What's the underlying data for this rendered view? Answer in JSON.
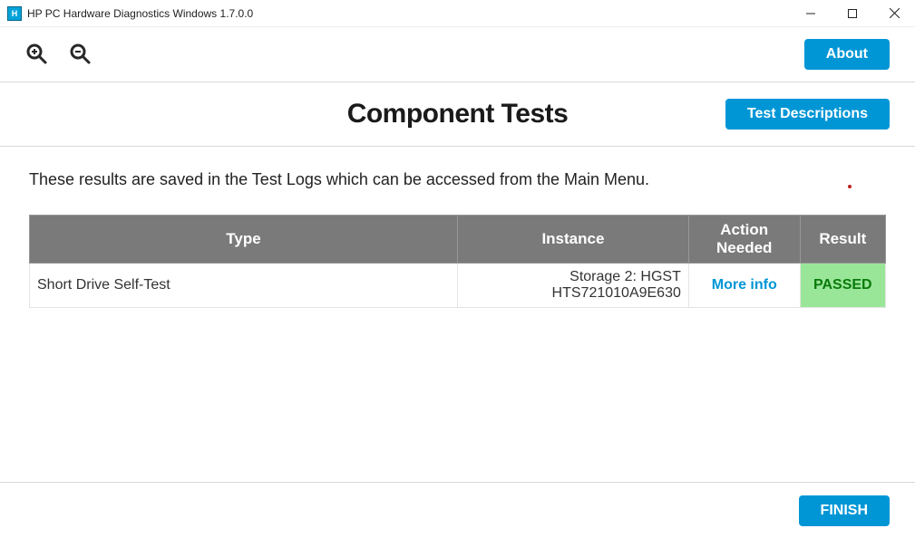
{
  "window": {
    "title": "HP PC Hardware Diagnostics Windows 1.7.0.0"
  },
  "toolbar": {
    "about_label": "About"
  },
  "page": {
    "title": "Component Tests",
    "test_descriptions_label": "Test Descriptions",
    "intro": "These results are saved in the Test Logs which can be accessed from the Main Menu."
  },
  "table": {
    "headers": {
      "type": "Type",
      "instance": "Instance",
      "action": "Action Needed",
      "result": "Result"
    },
    "rows": [
      {
        "type": "Short Drive Self-Test",
        "instance": "Storage 2: HGST HTS721010A9E630",
        "action": "More info",
        "result": "PASSED"
      }
    ]
  },
  "footer": {
    "finish_label": "FINISH"
  }
}
